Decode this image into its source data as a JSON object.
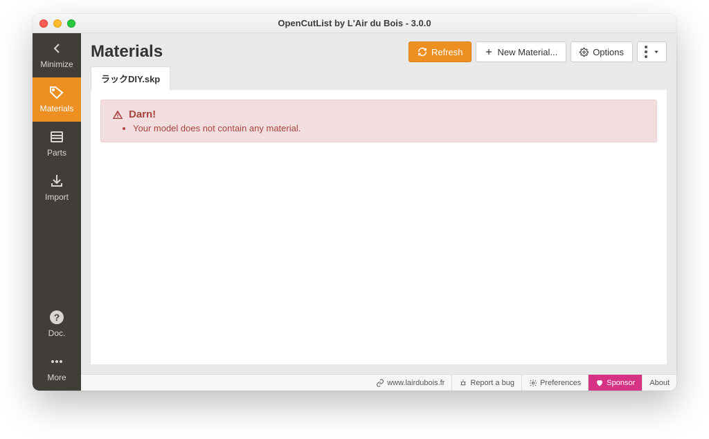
{
  "window": {
    "title": "OpenCutList by L'Air du Bois - 3.0.0"
  },
  "sidebar": {
    "minimize": "Minimize",
    "materials": "Materials",
    "parts": "Parts",
    "import": "Import",
    "doc": "Doc.",
    "more": "More"
  },
  "header": {
    "title": "Materials",
    "refresh": "Refresh",
    "new_material": "New Material...",
    "options": "Options"
  },
  "tabs": {
    "file": "ラックDIY.skp"
  },
  "alert": {
    "title": "Darn!",
    "message": "Your model does not contain any material."
  },
  "footer": {
    "site": "www.lairdubois.fr",
    "bug": "Report a bug",
    "prefs": "Preferences",
    "sponsor": "Sponsor",
    "about": "About"
  }
}
